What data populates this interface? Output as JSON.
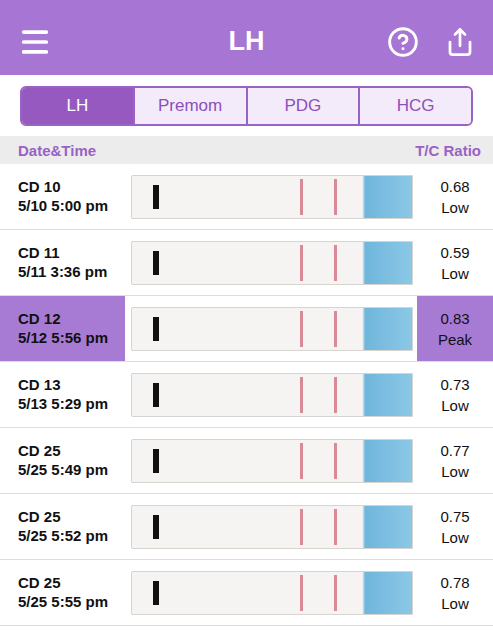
{
  "header": {
    "title": "LH"
  },
  "tabs": [
    {
      "label": "LH",
      "selected": true
    },
    {
      "label": "Premom",
      "selected": false
    },
    {
      "label": "PDG",
      "selected": false
    },
    {
      "label": "HCG",
      "selected": false
    }
  ],
  "table": {
    "columns": [
      "Date&Time",
      "T/C Ratio"
    ],
    "rows": [
      {
        "cycle_day": "CD 10",
        "datetime": "5/10 5:00 pm",
        "ratio": "0.68",
        "result": "Low",
        "selected": false
      },
      {
        "cycle_day": "CD 11",
        "datetime": "5/11 3:36 pm",
        "ratio": "0.59",
        "result": "Low",
        "selected": false
      },
      {
        "cycle_day": "CD 12",
        "datetime": "5/12 5:56 pm",
        "ratio": "0.83",
        "result": "Peak",
        "selected": true
      },
      {
        "cycle_day": "CD 13",
        "datetime": "5/13 5:29 pm",
        "ratio": "0.73",
        "result": "Low",
        "selected": false
      },
      {
        "cycle_day": "CD 25",
        "datetime": "5/25 5:49 pm",
        "ratio": "0.77",
        "result": "Low",
        "selected": false
      },
      {
        "cycle_day": "CD 25",
        "datetime": "5/25 5:52 pm",
        "ratio": "0.75",
        "result": "Low",
        "selected": false
      },
      {
        "cycle_day": "CD 25",
        "datetime": "5/25 5:55 pm",
        "ratio": "0.78",
        "result": "Low",
        "selected": false
      }
    ]
  }
}
